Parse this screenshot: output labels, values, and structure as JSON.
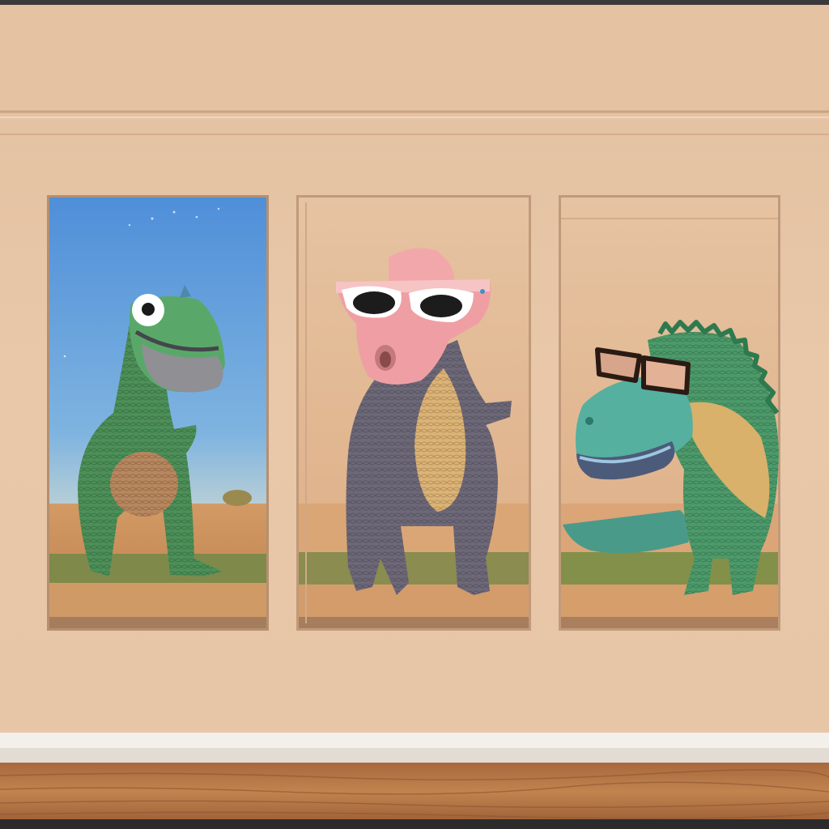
{
  "scene": {
    "subject": "three-dinosaur-paintings-on-wall",
    "colors": {
      "wall": "#e6c3a3",
      "wall_dark": "#dbb493",
      "baseboard": "#f1ede8",
      "floor": "#b97a4d",
      "frame": "#c79d7c",
      "sky": "#6aa3d9",
      "ground": "#d6965e",
      "grass": "#7b8a48",
      "dino_green": "#4a8f5a",
      "dino_grey": "#6b6674",
      "dino_belly": "#d9b074",
      "pink_head": "#f0a6a8"
    },
    "paintings": [
      {
        "name": "green-dino-with-grey-visor",
        "background": "sky"
      },
      {
        "name": "grey-dino-with-pink-mask-and-sunglasses",
        "background": "plain"
      },
      {
        "name": "teal-dino-with-glasses",
        "background": "plain"
      }
    ]
  }
}
